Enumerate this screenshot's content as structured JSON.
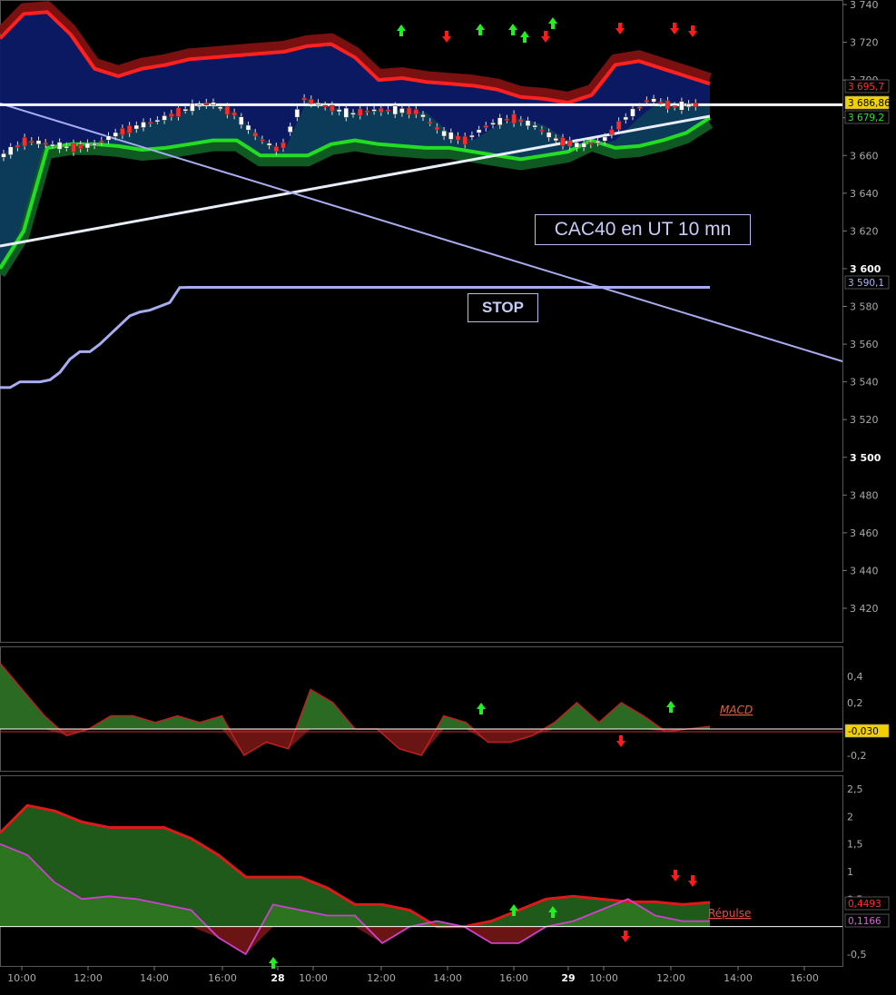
{
  "annotations": {
    "title": "CAC40 en UT 10 mn",
    "stop": "STOP"
  },
  "colors": {
    "background": "#000000",
    "bull_candle": "#ffffff",
    "bear_candle": "#ff2a2a",
    "upper_band": "#ff2020",
    "lower_band": "#22dd22",
    "stop_line": "#a8acf0",
    "up_arrow": "#22ee22",
    "down_arrow": "#ff1a1a"
  },
  "chart_data": [
    {
      "type": "candlestick",
      "instrument": "CAC40",
      "timeframe": "10 mn",
      "ylim": [
        3400,
        3740
      ],
      "y_ticks": [
        "3 740",
        "3 720",
        "3 700",
        "3 680",
        "3 660",
        "3 640",
        "3 620",
        "3 600",
        "3 580",
        "3 560",
        "3 540",
        "3 520",
        "3 500",
        "3 480",
        "3 460",
        "3 440",
        "3 420"
      ],
      "x_ticks": [
        "10:00",
        "12:00",
        "14:00",
        "16:00",
        "28",
        "10:00",
        "12:00",
        "14:00",
        "16:00",
        "29",
        "10:00",
        "12:00",
        "14:00",
        "16:00"
      ],
      "last_values": {
        "upper": "3 695,7",
        "price": "3 686,86",
        "lower": "3 679,2",
        "stop": "3 590,1"
      },
      "last_price": 3686.86,
      "stop_level": 3590.1,
      "stop_series": [
        3537,
        3537,
        3540,
        3540,
        3540,
        3541,
        3545,
        3552,
        3556,
        3556,
        3560,
        3565,
        3570,
        3575,
        3577,
        3578,
        3580,
        3582,
        3590,
        3590.1
      ],
      "upper_band": [
        3722,
        3735,
        3736,
        3724,
        3706,
        3702,
        3706,
        3708,
        3711,
        3712,
        3713,
        3714,
        3715,
        3718,
        3719,
        3712,
        3700,
        3701,
        3699,
        3698,
        3697,
        3695,
        3691,
        3690,
        3688,
        3692,
        3708,
        3710,
        3706,
        3702,
        3698
      ],
      "lower_band": [
        3600,
        3620,
        3664,
        3666,
        3666,
        3665,
        3663,
        3664,
        3666,
        3668,
        3668,
        3660,
        3660,
        3660,
        3666,
        3668,
        3666,
        3665,
        3664,
        3664,
        3662,
        3660,
        3658,
        3660,
        3662,
        3668,
        3664,
        3665,
        3668,
        3672,
        3680
      ],
      "price_close": [
        3660,
        3668,
        3666,
        3664,
        3666,
        3672,
        3676,
        3680,
        3685,
        3688,
        3682,
        3670,
        3662,
        3690,
        3686,
        3682,
        3684,
        3684,
        3683,
        3672,
        3668,
        3676,
        3680,
        3676,
        3668,
        3665,
        3668,
        3680,
        3690,
        3686,
        3686.86
      ],
      "up_signals": [
        "t1",
        "t2",
        "t3",
        "t4",
        "t5"
      ],
      "down_signals": [
        "t1",
        "t2",
        "t3",
        "t4",
        "t5"
      ]
    },
    {
      "type": "area",
      "name": "MACD",
      "ylim": [
        -0.3,
        0.55
      ],
      "y_ticks": [
        "0,4",
        "0,2",
        "-0,2"
      ],
      "last_value": "-0,030",
      "values": [
        0.5,
        0.3,
        0.1,
        -0.05,
        0.0,
        0.1,
        0.1,
        0.05,
        0.1,
        0.05,
        0.1,
        -0.2,
        -0.1,
        -0.15,
        0.3,
        0.2,
        0.0,
        0.0,
        -0.15,
        -0.2,
        0.1,
        0.05,
        -0.1,
        -0.1,
        -0.05,
        0.05,
        0.2,
        0.05,
        0.2,
        0.1,
        -0.02,
        0.0,
        0.02
      ]
    },
    {
      "type": "area",
      "name": "Répulse",
      "ylim": [
        -0.7,
        2.7
      ],
      "y_ticks": [
        "2,5",
        "2",
        "1,5",
        "1",
        "0,5",
        "-0,5"
      ],
      "last_values": [
        "0,4493",
        "0,1166"
      ],
      "fast": [
        1.5,
        1.3,
        0.8,
        0.5,
        0.55,
        0.5,
        0.4,
        0.3,
        -0.2,
        -0.5,
        0.4,
        0.3,
        0.2,
        0.2,
        -0.3,
        0.0,
        0.1,
        0.0,
        -0.3,
        -0.3,
        0.0,
        0.1,
        0.3,
        0.5,
        0.2,
        0.1,
        0.1
      ],
      "slow": [
        1.7,
        2.2,
        2.1,
        1.9,
        1.8,
        1.8,
        1.8,
        1.6,
        1.3,
        0.9,
        0.9,
        0.9,
        0.7,
        0.4,
        0.4,
        0.3,
        0.0,
        0.0,
        0.1,
        0.3,
        0.5,
        0.55,
        0.5,
        0.45,
        0.45,
        0.4,
        0.44
      ]
    }
  ]
}
